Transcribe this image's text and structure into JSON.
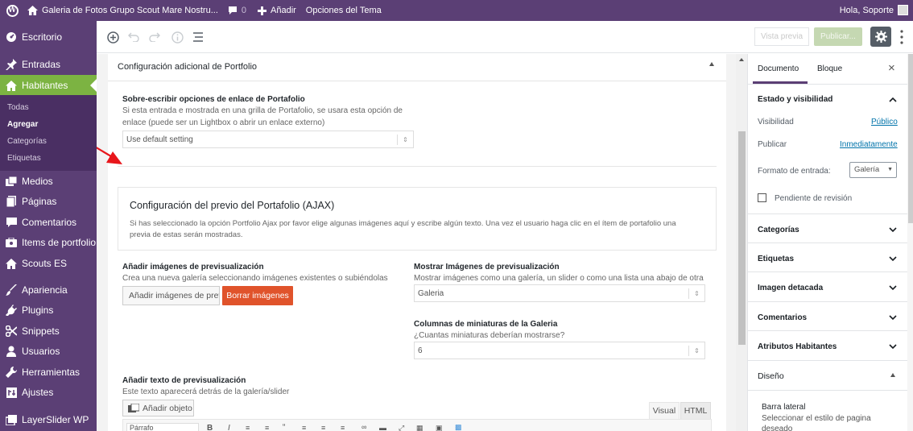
{
  "admin_bar": {
    "site_name": "Galeria de Fotos Grupo Scout Mare Nostru...",
    "comments_count": "0",
    "new_label": "Añadir",
    "theme_options": "Opciones del Tema",
    "greeting": "Hola, Soporte"
  },
  "sidebar": {
    "items": [
      {
        "label": "Escritorio",
        "icon": "dashboard-icon"
      },
      {
        "label": "Entradas",
        "icon": "pin-icon"
      },
      {
        "label": "Habitantes",
        "icon": "home-icon"
      },
      {
        "label": "Medios",
        "icon": "media-icon"
      },
      {
        "label": "Páginas",
        "icon": "pages-icon"
      },
      {
        "label": "Comentarios",
        "icon": "comment-icon"
      },
      {
        "label": "Items de portfolio",
        "icon": "portfolio-icon"
      },
      {
        "label": "Scouts ES",
        "icon": "home-icon"
      },
      {
        "label": "Apariencia",
        "icon": "brush-icon"
      },
      {
        "label": "Plugins",
        "icon": "plugin-icon"
      },
      {
        "label": "Snippets",
        "icon": "scissors-icon"
      },
      {
        "label": "Usuarios",
        "icon": "user-icon"
      },
      {
        "label": "Herramientas",
        "icon": "wrench-icon"
      },
      {
        "label": "Ajustes",
        "icon": "settings-icon"
      },
      {
        "label": "LayerSlider WP",
        "icon": "layers-icon"
      }
    ],
    "submenu": [
      "Todas",
      "Agregar",
      "Categorías",
      "Etiquetas"
    ]
  },
  "header": {
    "preview_label": "Vista previa",
    "publish_label": "Publicar..."
  },
  "portfolio": {
    "section_title": "Configuración adicional de Portfolio",
    "override_label": "Sobre-escribir opciones de enlace de Portafolio",
    "override_desc1": "Si esta entrada e mostrada en una grilla de Portafolio, se usara esta opción de",
    "override_desc2": "enlace (puede ser un Lightbox o abrir un enlace externo)",
    "override_value": "Use default setting",
    "ajax_title": "Configuración del previo del Portafolio (AJAX)",
    "ajax_desc1": "Si has seleccionado la opción Portfolio Ajax por favor elige algunas imágenes aquí y escribe algún texto. Una vez el usuario haga clic en el ítem de portafolio una",
    "ajax_desc2": "previa de estas serán mostradas.",
    "add_images_label": "Añadir imágenes de previsualización",
    "add_images_desc": "Crea una nueva galería seleccionando imágenes existentes o subiéndolas",
    "add_images_button": "Añadir imágenes de previsu",
    "delete_images_button": "Borrar imágenes",
    "show_images_label": "Mostrar Imágenes de previsualización",
    "show_images_desc": "Mostrar imágenes como una galería, un slider o como una lista una abajo de otra",
    "show_images_value": "Galeria",
    "columns_label": "Columnas de miniaturas de la Galeria",
    "columns_desc": "¿Cuantas miniaturas deberían mostrarse?",
    "columns_value": "6",
    "text_label": "Añadir texto de previsualización",
    "text_desc": "Este texto aparecerá detrás de la galería/slider",
    "add_object_button": "Añadir objeto",
    "tab_visual": "Visual",
    "tab_html": "HTML",
    "paragraph_select": "Párrafo"
  },
  "right_panel": {
    "tab_document": "Documento",
    "tab_block": "Bloque",
    "status_title": "Estado y visibilidad",
    "visibility_label": "Visibilidad",
    "visibility_value": "Público",
    "publish_label": "Publicar",
    "publish_value": "Inmediatamente",
    "format_label": "Formato de entrada:",
    "format_value": "Galería",
    "pending_label": "Pendiente de revisión",
    "sections": [
      "Categorías",
      "Etiquetas",
      "Imagen detacada",
      "Comentarios",
      "Atributos Habitantes",
      "Diseño"
    ],
    "sidebar_title": "Barra lateral",
    "sidebar_desc": "Seleccionar el estilo de pagina deseado"
  },
  "colors": {
    "admin_purple": "#5b3f75",
    "active_green": "#7cb342",
    "danger_orange": "#e0532b",
    "arrow_red": "#e8161b"
  }
}
